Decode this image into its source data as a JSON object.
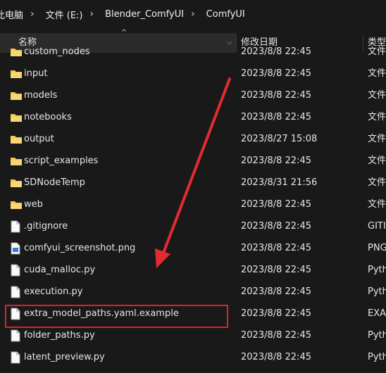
{
  "breadcrumb": [
    "此电脑",
    "文件 (E:)",
    "Blender_ComfyUI",
    "ComfyUI"
  ],
  "columns": {
    "name": "名称",
    "date": "修改日期",
    "type": "类型"
  },
  "rows": [
    {
      "name": "custom_nodes",
      "date": "2023/8/8 22:45",
      "type": "文件夹",
      "kind": "folder"
    },
    {
      "name": "input",
      "date": "2023/8/8 22:45",
      "type": "文件夹",
      "kind": "folder"
    },
    {
      "name": "models",
      "date": "2023/8/8 22:45",
      "type": "文件夹",
      "kind": "folder"
    },
    {
      "name": "notebooks",
      "date": "2023/8/8 22:45",
      "type": "文件夹",
      "kind": "folder"
    },
    {
      "name": "output",
      "date": "2023/8/27 15:08",
      "type": "文件夹",
      "kind": "folder"
    },
    {
      "name": "script_examples",
      "date": "2023/8/8 22:45",
      "type": "文件夹",
      "kind": "folder"
    },
    {
      "name": "SDNodeTemp",
      "date": "2023/8/31 21:56",
      "type": "文件夹",
      "kind": "folder"
    },
    {
      "name": "web",
      "date": "2023/8/8 22:45",
      "type": "文件夹",
      "kind": "folder"
    },
    {
      "name": ".gitignore",
      "date": "2023/8/8 22:45",
      "type": "GITIGNORE",
      "kind": "file"
    },
    {
      "name": "comfyui_screenshot.png",
      "date": "2023/8/8 22:45",
      "type": "PNG",
      "kind": "png"
    },
    {
      "name": "cuda_malloc.py",
      "date": "2023/8/8 22:45",
      "type": "Python",
      "kind": "file"
    },
    {
      "name": "execution.py",
      "date": "2023/8/8 22:45",
      "type": "Python",
      "kind": "file"
    },
    {
      "name": "extra_model_paths.yaml.example",
      "date": "2023/8/8 22:45",
      "type": "EXAMPLE",
      "kind": "file",
      "highlighted": true
    },
    {
      "name": "folder_paths.py",
      "date": "2023/8/8 22:45",
      "type": "Python",
      "kind": "file"
    },
    {
      "name": "latent_preview.py",
      "date": "2023/8/8 22:45",
      "type": "Python",
      "kind": "file"
    }
  ],
  "colors": {
    "folder": "#f2c94c",
    "highlight": "#d9232d",
    "arrow": "#e02b32"
  }
}
